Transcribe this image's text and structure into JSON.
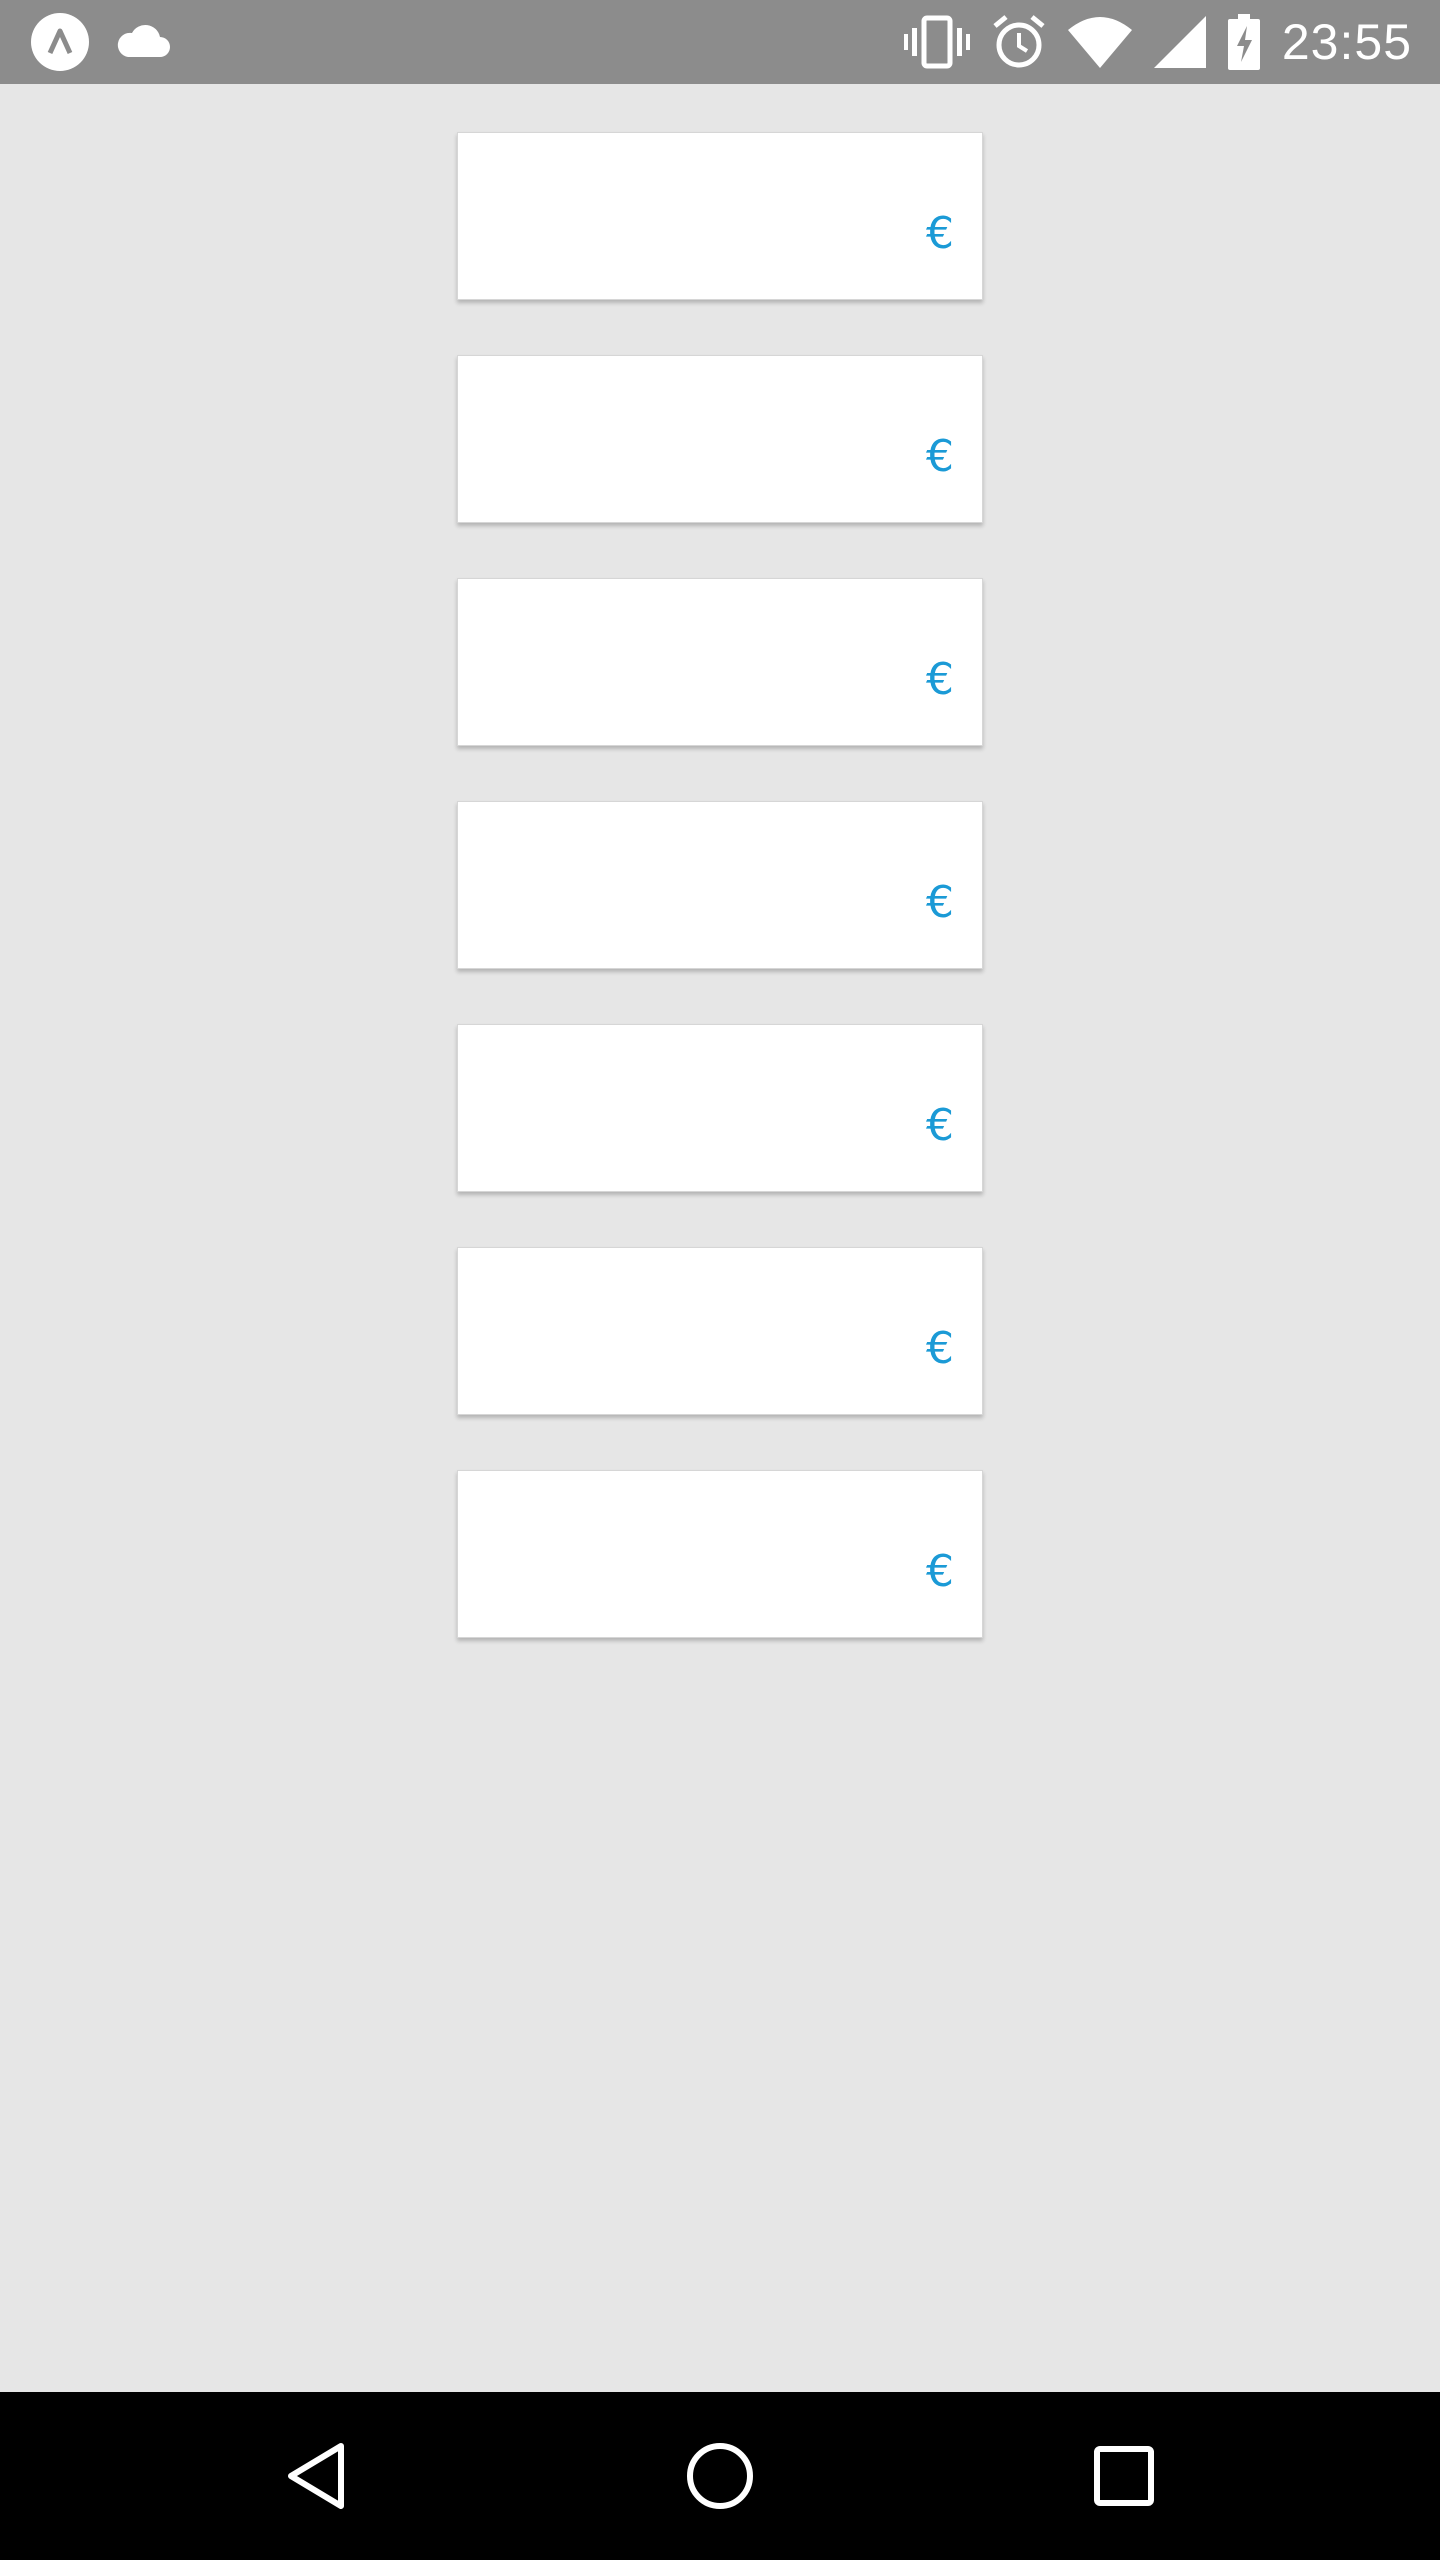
{
  "status_bar": {
    "time": "23:55",
    "left_icons": [
      "app-notification-icon",
      "cloud-icon"
    ],
    "right_icons": [
      "vibrate-icon",
      "alarm-icon",
      "wifi-icon",
      "cell-signal-icon",
      "battery-charging-icon"
    ]
  },
  "cards": [
    {
      "value": "",
      "currency": "€"
    },
    {
      "value": "",
      "currency": "€"
    },
    {
      "value": "",
      "currency": "€"
    },
    {
      "value": "",
      "currency": "€"
    },
    {
      "value": "",
      "currency": "€"
    },
    {
      "value": "",
      "currency": "€"
    },
    {
      "value": "",
      "currency": "€"
    }
  ],
  "navigation": {
    "icons": [
      "back-icon",
      "home-icon",
      "recents-icon"
    ]
  },
  "colors": {
    "status_bar": "#8c8c8c",
    "background": "#e6e6e6",
    "card": "#ffffff",
    "accent": "#1b9ad6",
    "nav_bar": "#000000"
  }
}
